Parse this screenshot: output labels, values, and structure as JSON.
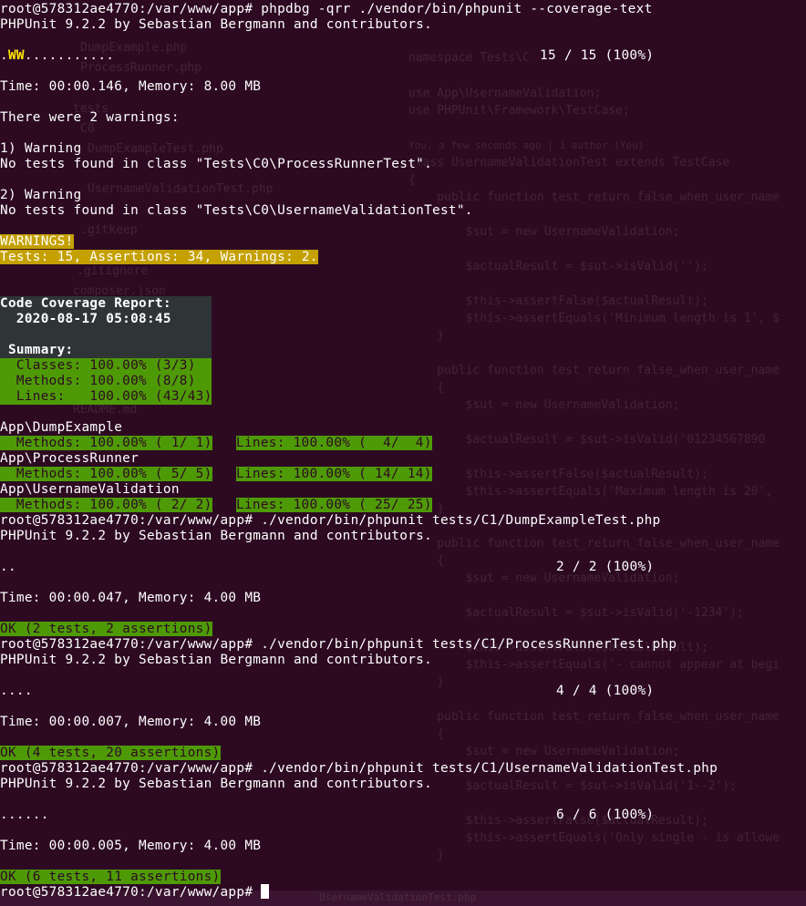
{
  "terminal": {
    "cmd1": "root@578312ae4770:/var/www/app# phpdbg -qrr ./vendor/bin/phpunit --coverage-text",
    "phpunit_banner": "PHPUnit 9.2.2 by Sebastian Bergmann and contributors.",
    "run1_dots_a": ".",
    "run1_ww": "WW",
    "run1_dots_b": "...........",
    "run1_progress": "15 / 15 (100%)",
    "run1_time": "Time: 00:00.146, Memory: 8.00 MB",
    "warnings_header": "There were 2 warnings:",
    "warning1_title": "1) Warning",
    "warning1_msg": "No tests found in class \"Tests\\C0\\ProcessRunnerTest\".",
    "warning2_title": "2) Warning",
    "warning2_msg": "No tests found in class \"Tests\\C0\\UsernameValidationTest\".",
    "warnings_banner": "WARNINGS!",
    "warnings_summary": "Tests: 15, Assertions: 34, Warnings: 2.",
    "coverage_title": "Code Coverage Report:",
    "coverage_date": "  2020-08-17 05:08:45",
    "summary_label": " Summary:",
    "summary_classes": "  Classes: 100.00% (3/3)",
    "summary_methods": "  Methods: 100.00% (8/8)",
    "summary_lines": "  Lines:   100.00% (43/43)",
    "class1_name": "App\\DumpExample",
    "class1_methods": "  Methods: 100.00% ( 1/ 1)",
    "class1_lines": "Lines: 100.00% (  4/  4)",
    "class2_name": "App\\ProcessRunner",
    "class2_methods": "  Methods: 100.00% ( 5/ 5)",
    "class2_lines": "Lines: 100.00% ( 14/ 14)",
    "class3_name": "App\\UsernameValidation",
    "class3_methods": "  Methods: 100.00% ( 2/ 2)",
    "class3_lines": "Lines: 100.00% ( 25/ 25)",
    "cmd2": "root@578312ae4770:/var/www/app# ./vendor/bin/phpunit tests/C1/DumpExampleTest.php",
    "run2_dots": "..",
    "run2_progress": "2 / 2 (100%)",
    "run2_time": "Time: 00:00.047, Memory: 4.00 MB",
    "run2_ok": "OK (2 tests, 2 assertions)",
    "cmd3": "root@578312ae4770:/var/www/app# ./vendor/bin/phpunit tests/C1/ProcessRunnerTest.php",
    "run3_dots": "....",
    "run3_progress": "4 / 4 (100%)",
    "run3_time": "Time: 00:00.007, Memory: 4.00 MB",
    "run3_ok": "OK (4 tests, 20 assertions)",
    "cmd4": "root@578312ae4770:/var/www/app# ./vendor/bin/phpunit tests/C1/UsernameValidationTest.php",
    "run4_dots": "......",
    "run4_progress": "6 / 6 (100%)",
    "run4_time": "Time: 00:00.005, Memory: 4.00 MB",
    "run4_ok": "OK (6 tests, 11 assertions)",
    "prompt": "root@578312ae4770:/var/www/app# "
  },
  "background_editor": {
    "sidebar_items": [
      "DumpExample.php",
      "ProcessRunner.php",
      "tests",
      "C0",
      "DumpExampleTest.php",
      "UsernameValidationTest.php",
      ".gitkeep",
      ".gitignore",
      "composer.json",
      "README.md"
    ],
    "code_lines": [
      "namespace Tests\\C",
      "use App\\UsernameValidation;",
      "use PHPUnit\\Framework\\TestCase;",
      "You, a few seconds ago | 1 author (You)",
      "class UsernameValidationTest extends TestCase",
      "{",
      "    public function test_return_false_when_user_name",
      "        $sut = new UsernameValidation;",
      "        $actualResult = $sut->isValid('');",
      "        $this->assertFalse($actualResult);",
      "        $this->assertEquals('Minimum length is 1', $",
      "    }",
      "    public function test_return_false_when_user_name",
      "    {",
      "        $sut = new UsernameValidation;",
      "        $actualResult = $sut->isValid('01234567890",
      "        $this->assertFalse($actualResult);",
      "        $this->assertEquals('Maximum length is 20',",
      "    }",
      "    public function test_return_false_when_user_name",
      "    {",
      "        $sut = new UsernameValidation;",
      "        $actualResult = $sut->isValid('-1234');",
      "        $this->assertFalse($actualResult);",
      "        $this->assertEquals('- cannot appear at begi",
      "    }",
      "    public function test_return_false_when_user_name",
      "    {",
      "        $sut = new UsernameValidation;",
      "        $actualResult = $sut->isValid('1--2');",
      "        $this->assertFalse($actualResult);",
      "        $this->assertEquals('Only single - is allowe",
      "    }"
    ],
    "status_tab": "UsernameValidationTest.php"
  }
}
